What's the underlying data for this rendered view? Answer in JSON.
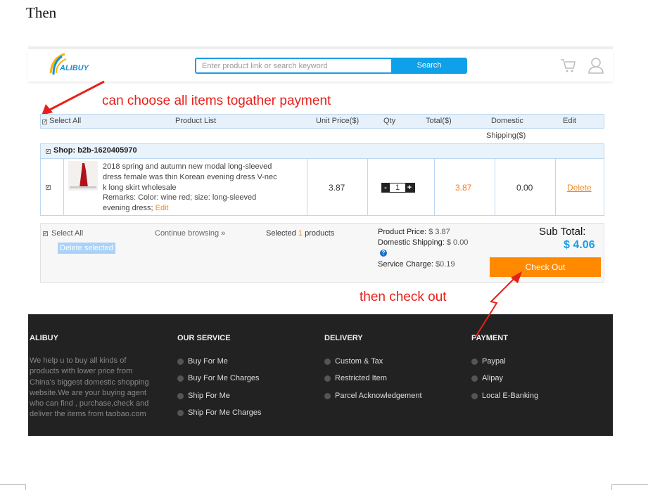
{
  "doc_caption": "Then",
  "header": {
    "logo": "ALIBUY",
    "search_placeholder": "Enter product link or search keyword",
    "search_button": "Search"
  },
  "annotations": {
    "select_all_note": "can choose all items togather payment",
    "checkout_note": "then check out"
  },
  "table": {
    "headers": [
      "Select All",
      "Product List",
      "Unit Price($)",
      "Qty",
      "Total($)",
      "Domestic",
      "Edit"
    ],
    "header_domestic_line2": "Shipping($)",
    "shop": "Shop: b2b-1620405970",
    "item": {
      "title_lines": [
        "2018 spring and autumn new modal long-sleeved",
        "dress female was thin Korean evening dress V-nec",
        "k long skirt wholesale"
      ],
      "remarks_lines": [
        "Remarks: Color: wine red; size: long-sleeved",
        "evening dress;"
      ],
      "edit": "Edit",
      "unit_price": "3.87",
      "qty": "1",
      "total": "3.87",
      "shipping": "0.00",
      "delete": "Delete"
    }
  },
  "summary": {
    "select_all": "Select All",
    "delete_selected": "Delete selected",
    "continue": "Continue browsing »",
    "selected_prefix": "Selected",
    "selected_count": "1",
    "selected_suffix": "products",
    "product_price_label": "Product Price:",
    "product_price": "$ 3.87",
    "shipping_label": "Domestic Shipping:",
    "shipping": "$ 0.00",
    "service_label": "Service Charge:",
    "service": "$0.19",
    "subtotal_label": "Sub Total:",
    "subtotal": "$ 4.06",
    "checkout": "Check Out"
  },
  "footer": {
    "about_title": "ALIBUY",
    "about_text": "We help u to buy all kinds of products with lower price from China's biggest domestic shopping website.We are your buying agent who can find , purchase,check and deliver the items from taobao.com",
    "columns": [
      {
        "title": "OUR SERVICE",
        "items": [
          "Buy For Me",
          "Buy For Me Charges",
          "Ship For Me",
          "Ship For Me Charges"
        ]
      },
      {
        "title": "DELIVERY",
        "items": [
          "Custom & Tax",
          "Restricted Item",
          "Parcel Acknowledgement"
        ]
      },
      {
        "title": "PAYMENT",
        "items": [
          "Paypal",
          "Alipay",
          "Local E-Banking"
        ]
      }
    ]
  },
  "colors": {
    "accent_blue": "#0ea0e8",
    "orange": "#ff8a00",
    "annotation_red": "#e8201a",
    "footer_bg": "#222222"
  }
}
